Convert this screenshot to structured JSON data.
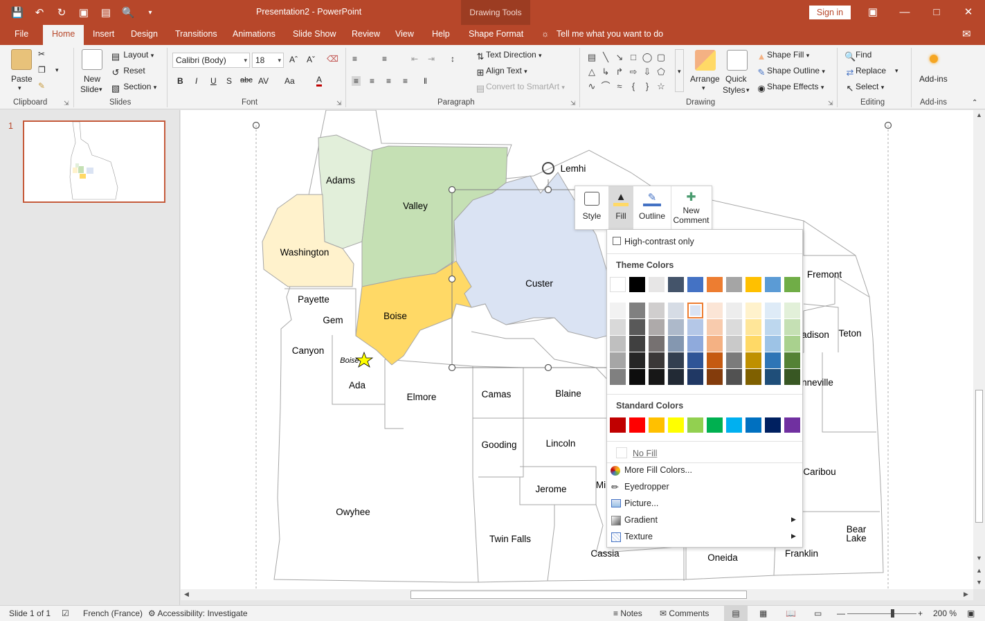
{
  "window": {
    "document_title": "Presentation2  -  PowerPoint",
    "context_tab": "Drawing Tools",
    "sign_in": "Sign in"
  },
  "tabs": [
    "File",
    "Home",
    "Insert",
    "Design",
    "Transitions",
    "Animations",
    "Slide Show",
    "Review",
    "View",
    "Help",
    "Shape Format"
  ],
  "active_tab": "Home",
  "tell_me": "Tell me what you want to do",
  "ribbon": {
    "clipboard": {
      "label": "Clipboard",
      "paste": "Paste"
    },
    "slides": {
      "label": "Slides",
      "new_slide": "New",
      "new_slide2": "Slide",
      "layout": "Layout",
      "reset": "Reset",
      "section": "Section"
    },
    "font": {
      "label": "Font",
      "font_name": "Calibri (Body)",
      "font_size": "18",
      "bold": "B",
      "italic": "I",
      "underline": "U",
      "strike": "S",
      "strike_abc": "abc",
      "spacing": "AV",
      "case": "Aa",
      "color": "A"
    },
    "paragraph": {
      "label": "Paragraph",
      "text_direction": "Text Direction",
      "align_text": "Align Text",
      "smartart": "Convert to SmartArt"
    },
    "drawing": {
      "label": "Drawing",
      "arrange": "Arrange",
      "quick": "Quick",
      "styles": "Styles",
      "shape_fill": "Shape Fill",
      "shape_outline": "Shape Outline",
      "shape_effects": "Shape Effects"
    },
    "editing": {
      "label": "Editing",
      "find": "Find",
      "replace": "Replace",
      "select": "Select"
    },
    "addins": {
      "label": "Add-ins",
      "button": "Add-ins"
    }
  },
  "thumbnail": {
    "number": "1"
  },
  "map": {
    "counties": [
      {
        "name": "Adams",
        "fill": "#e2efda"
      },
      {
        "name": "Valley",
        "fill": "#c5e0b4"
      },
      {
        "name": "Washington",
        "fill": "#fff2cc"
      },
      {
        "name": "Custer",
        "fill": "#dae3f3"
      },
      {
        "name": "Boise",
        "fill": "#ffd966"
      },
      {
        "name": "Payette"
      },
      {
        "name": "Gem"
      },
      {
        "name": "Canyon"
      },
      {
        "name": "Ada"
      },
      {
        "name": "Elmore"
      },
      {
        "name": "Camas"
      },
      {
        "name": "Blaine"
      },
      {
        "name": "Gooding"
      },
      {
        "name": "Lincoln"
      },
      {
        "name": "Jerome"
      },
      {
        "name": "Owyhee"
      },
      {
        "name": "Twin Falls"
      },
      {
        "name": "Cassia"
      },
      {
        "name": "Oneida"
      },
      {
        "name": "Franklin"
      },
      {
        "name": "Bear"
      },
      {
        "name": "Lake"
      },
      {
        "name": "Caribou"
      },
      {
        "name": "Fremont"
      },
      {
        "name": "Teton"
      },
      {
        "name": "adison"
      },
      {
        "name": "nneville"
      },
      {
        "name": "Mi"
      },
      {
        "name": "Lemhi"
      }
    ],
    "city": "Boise"
  },
  "mini_toolbar": {
    "style": "Style",
    "fill": "Fill",
    "outline": "Outline",
    "new_comment_1": "New",
    "new_comment_2": "Comment"
  },
  "fill_menu": {
    "high_contrast": "High-contrast only",
    "theme_colors_title": "Theme Colors",
    "theme_top": [
      "#ffffff",
      "#000000",
      "#e7e6e6",
      "#44546a",
      "#4472c4",
      "#ed7d31",
      "#a5a5a5",
      "#ffc000",
      "#5b9bd5",
      "#70ad47"
    ],
    "theme_shades": [
      [
        "#f2f2f2",
        "#d9d9d9",
        "#bfbfbf",
        "#a6a6a6",
        "#808080"
      ],
      [
        "#808080",
        "#595959",
        "#404040",
        "#262626",
        "#0d0d0d"
      ],
      [
        "#d0cece",
        "#aeaaaa",
        "#767171",
        "#3b3838",
        "#171717"
      ],
      [
        "#d6dce5",
        "#adb9ca",
        "#8497b0",
        "#333f50",
        "#222a35"
      ],
      [
        "#dae3f3",
        "#b4c7e7",
        "#8faadc",
        "#2f5597",
        "#203864"
      ],
      [
        "#fbe5d6",
        "#f8cbad",
        "#f4b183",
        "#c55a11",
        "#843c0c"
      ],
      [
        "#ededed",
        "#dbdbdb",
        "#c9c9c9",
        "#7b7b7b",
        "#525252"
      ],
      [
        "#fff2cc",
        "#ffe699",
        "#ffd966",
        "#bf9000",
        "#7f6000"
      ],
      [
        "#deebf7",
        "#bdd7ee",
        "#9dc3e6",
        "#2e75b6",
        "#1f4e79"
      ],
      [
        "#e2f0d9",
        "#c5e0b4",
        "#a9d18e",
        "#548235",
        "#385723"
      ]
    ],
    "standard_colors_title": "Standard Colors",
    "standard": [
      "#c00000",
      "#ff0000",
      "#ffc000",
      "#ffff00",
      "#92d050",
      "#00b050",
      "#00b0f0",
      "#0070c0",
      "#002060",
      "#7030a0"
    ],
    "no_fill": "No Fill",
    "more_colors": "More Fill Colors...",
    "eyedropper": "Eyedropper",
    "picture": "Picture...",
    "gradient": "Gradient",
    "texture": "Texture"
  },
  "status": {
    "slide": "Slide 1 of 1",
    "language": "French (France)",
    "accessibility": "Accessibility: Investigate",
    "notes": "Notes",
    "comments": "Comments",
    "zoom": "200 %"
  },
  "colors": {
    "accent": "#b7472a"
  }
}
